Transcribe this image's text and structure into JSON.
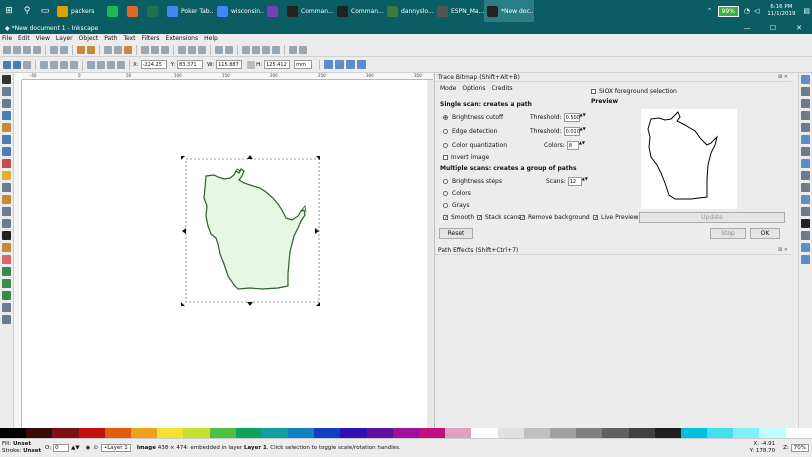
{
  "taskbar": {
    "apps": [
      {
        "label": "packers",
        "color": "#e0a000",
        "active": false
      },
      {
        "label": "",
        "color": "#1db954",
        "active": false
      },
      {
        "label": "",
        "color": "#e06a2a",
        "active": false
      },
      {
        "label": "",
        "color": "#217346",
        "active": false
      },
      {
        "label": "Poker Tab...",
        "color": "#4285f4",
        "active": false
      },
      {
        "label": "wisconsin...",
        "color": "#4285f4",
        "active": false
      },
      {
        "label": "",
        "color": "#7b3fb5",
        "active": false
      },
      {
        "label": "Comman...",
        "color": "#222222",
        "active": false
      },
      {
        "label": "Comman...",
        "color": "#222222",
        "active": false
      },
      {
        "label": "dannyslo...",
        "color": "#3a7a3a",
        "active": false
      },
      {
        "label": "ESPN_Ma...",
        "color": "#555555",
        "active": false
      },
      {
        "label": "*New doc...",
        "color": "#222222",
        "active": true
      }
    ],
    "battery": "99%",
    "clock_time": "6:16 PM",
    "clock_date": "11/1/2019"
  },
  "window": {
    "title": "*New document 1 - Inkscape"
  },
  "menu": [
    "File",
    "Edit",
    "View",
    "Layer",
    "Object",
    "Path",
    "Text",
    "Filters",
    "Extensions",
    "Help"
  ],
  "controls": {
    "x_label": "X:",
    "x_value": "-224.25",
    "y_label": "Y:",
    "y_value": "83.371",
    "w_label": "W:",
    "w_value": "115.887",
    "h_label": "H:",
    "h_value": "125.412",
    "unit": "mm"
  },
  "ruler_labels": [
    "-50",
    "0",
    "50",
    "100",
    "150",
    "200",
    "250",
    "300",
    "350"
  ],
  "trace": {
    "panel_title": "Trace Bitmap (Shift+Alt+B)",
    "tabs": [
      "Mode",
      "Options",
      "Credits"
    ],
    "single_heading": "Single scan: creates a path",
    "brightness_cutoff": "Brightness cutoff",
    "edge_detection": "Edge detection",
    "color_quantization": "Color quantization",
    "invert_image": "Invert image",
    "threshold_label": "Threshold:",
    "threshold_1": "0.500",
    "threshold_2": "0.010",
    "colors_label": "Colors:",
    "colors_value": "8",
    "multi_heading": "Multiple scans: creates a group of paths",
    "brightness_steps": "Brightness steps",
    "colors_opt": "Colors",
    "grays_opt": "Grays",
    "scans_label": "Scans:",
    "scans_value": "12",
    "smooth": "Smooth",
    "stack_scans": "Stack scans",
    "remove_background": "Remove background",
    "siox": "SIOX foreground selection",
    "preview_label": "Preview",
    "live_preview": "Live Preview",
    "update": "Update",
    "reset": "Reset",
    "stop": "Stop",
    "ok": "OK"
  },
  "path_effects": {
    "title": "Path Effects  (Shift+Ctrl+7)"
  },
  "status": {
    "fill_label": "Fill:",
    "fill_value": "Unset",
    "stroke_label": "Stroke:",
    "stroke_value": "Unset",
    "opacity_label": "O:",
    "opacity_value": "0",
    "layer": "•Layer 1",
    "message_bold": "Image",
    "message": " 438 × 474: embedded in layer ",
    "message_layer": "Layer 1",
    "message_end": ". Click selection to toggle scale/rotation handles.",
    "x": "X: -4.91",
    "y": "Y: 178.70",
    "zoom_label": "Z:",
    "zoom": "70%"
  },
  "colors": {
    "taskbar": "#0a5d63",
    "wisconsin_fill": "#e6f7e2",
    "wisconsin_stroke": "#2e5e2a",
    "battery": "#3cb043"
  }
}
